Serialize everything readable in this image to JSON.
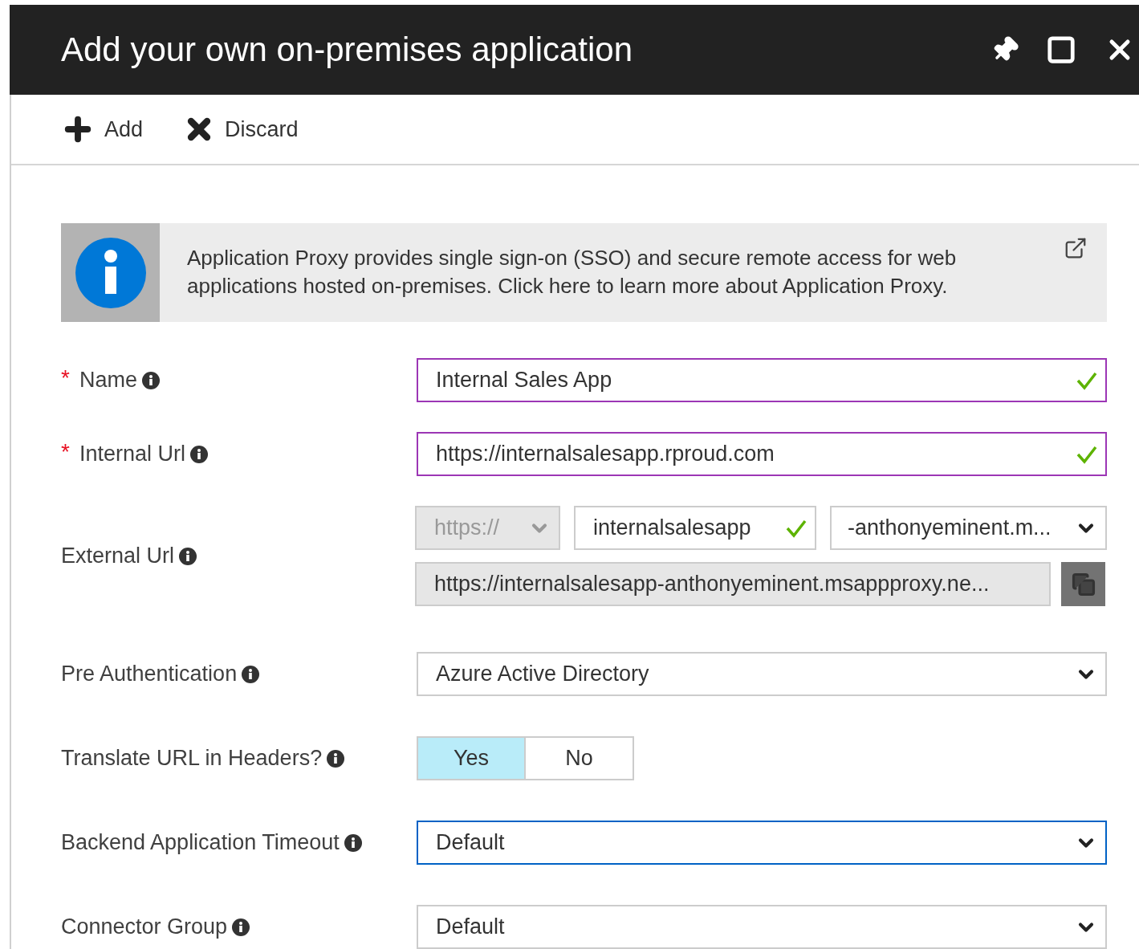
{
  "window": {
    "title": "Add your own on-premises application"
  },
  "toolbar": [
    {
      "kind": "add",
      "label": "Add"
    },
    {
      "kind": "discard",
      "label": "Discard"
    }
  ],
  "info_banner": {
    "lines": [
      "Application Proxy provides single sign-on (SSO) and secure remote access for web",
      "applications hosted on-premises. Click here to learn more about Application Proxy."
    ]
  },
  "fields": [
    {
      "kind": "text",
      "required_mark": "*",
      "label": "Name",
      "value": "Internal Sales App",
      "valid": true,
      "focused": false
    },
    {
      "kind": "text",
      "required_mark": "*",
      "label": "Internal Url",
      "value": "https://internalsalesapp.rproud.com",
      "valid": true,
      "focused": false
    },
    {
      "kind": "external_url",
      "label": "External Url",
      "scheme": {
        "value": "https://",
        "disabled": true
      },
      "subdomain": {
        "value": "internalsalesapp",
        "valid": true
      },
      "domain": {
        "value": "-anthonyeminent.m..."
      },
      "full_url": "https://internalsalesapp-anthonyeminent.msappproxy.ne..."
    },
    {
      "kind": "select",
      "label": "Pre Authentication",
      "value": "Azure Active Directory",
      "focused": false
    },
    {
      "kind": "toggle",
      "label": "Translate URL in Headers?",
      "options": [
        {
          "label": "Yes",
          "selected": true
        },
        {
          "label": "No",
          "selected": false
        }
      ]
    },
    {
      "kind": "select",
      "label": "Backend Application Timeout",
      "value": "Default",
      "focused": true
    },
    {
      "kind": "select",
      "label": "Connector Group",
      "value": "Default",
      "focused": false
    }
  ]
}
